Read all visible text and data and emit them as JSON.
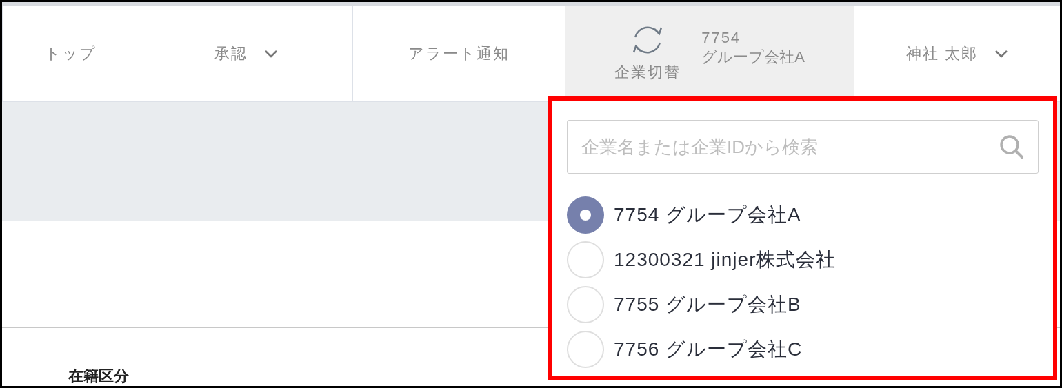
{
  "nav": [
    {
      "kind": "link",
      "label": "トップ"
    },
    {
      "kind": "menu",
      "label": "承認"
    },
    {
      "kind": "link",
      "label": "アラート通知"
    },
    {
      "kind": "company",
      "label": "企業切替",
      "company_id": "7754",
      "company_name": "グループ会社A"
    },
    {
      "kind": "menu",
      "label": "神社 太郎"
    }
  ],
  "company_dropdown": {
    "placeholder": "企業名または企業IDから検索",
    "options": [
      {
        "label": "7754 グループ会社A",
        "selected": true
      },
      {
        "label": "12300321 jinjer株式会社",
        "selected": false
      },
      {
        "label": "7755 グループ会社B",
        "selected": false
      },
      {
        "label": "7756 グループ会社C",
        "selected": false
      }
    ]
  },
  "section_heading": "在籍区分"
}
